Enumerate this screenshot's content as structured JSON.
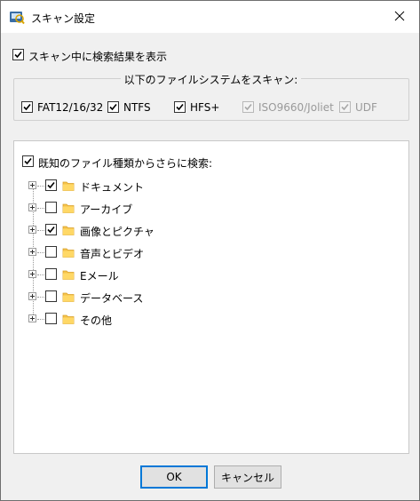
{
  "window": {
    "title": "スキャン設定",
    "app_icon": "scan-app-icon",
    "close_icon": "close-icon"
  },
  "options": {
    "show_results_label": "スキャン中に検索結果を表示",
    "show_results_checked": true
  },
  "filesystems": {
    "legend": "以下のファイルシステムをスキャン:",
    "items": [
      {
        "label": "FAT12/16/32",
        "checked": true,
        "enabled": true
      },
      {
        "label": "NTFS",
        "checked": true,
        "enabled": true
      },
      {
        "label": "HFS+",
        "checked": true,
        "enabled": true
      },
      {
        "label": "ISO9660/Joliet",
        "checked": true,
        "enabled": false
      },
      {
        "label": "UDF",
        "checked": true,
        "enabled": false
      }
    ]
  },
  "known_types": {
    "label": "既知のファイル種類からさらに検索:",
    "checked": true,
    "tree": [
      {
        "label": "ドキュメント",
        "checked": true
      },
      {
        "label": "アーカイブ",
        "checked": false
      },
      {
        "label": "画像とピクチャ",
        "checked": true
      },
      {
        "label": "音声とビデオ",
        "checked": false
      },
      {
        "label": "Eメール",
        "checked": false
      },
      {
        "label": "データベース",
        "checked": false
      },
      {
        "label": "その他",
        "checked": false
      }
    ]
  },
  "buttons": {
    "ok": "OK",
    "cancel": "キャンセル"
  },
  "colors": {
    "folder": "#f5c24a",
    "accent": "#0078d7"
  }
}
